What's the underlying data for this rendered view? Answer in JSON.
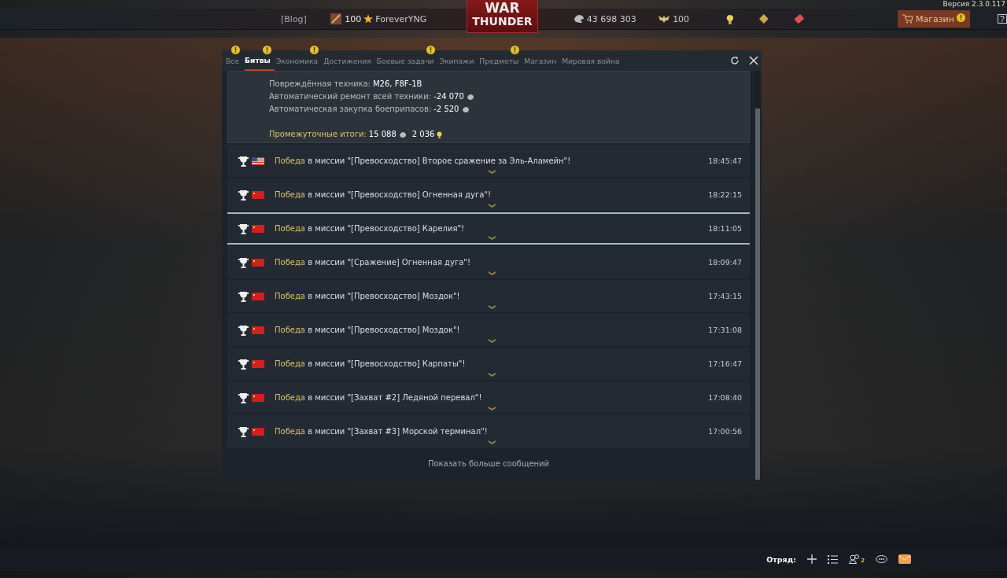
{
  "version": "Версия 2.3.0.117",
  "topbar": {
    "blog": "[Blog]",
    "level": "100",
    "username": "ForeverYNG",
    "logo_top": "WAR",
    "logo_bottom": "THUNDER",
    "silver": "43 698 303",
    "gold": "100",
    "shop": {
      "label": "Магазин",
      "alert": true
    },
    "help": "?"
  },
  "tabs": [
    {
      "label": "Все",
      "selected": false,
      "alert": true
    },
    {
      "label": "Битвы",
      "selected": true,
      "alert": true
    },
    {
      "label": "Экономика",
      "selected": false,
      "alert": true
    },
    {
      "label": "Достижения",
      "selected": false,
      "alert": false
    },
    {
      "label": "Боевые задачи",
      "selected": false,
      "alert": true
    },
    {
      "label": "Экипажи",
      "selected": false,
      "alert": false
    },
    {
      "label": "Предметы",
      "selected": false,
      "alert": true
    },
    {
      "label": "Магазин",
      "selected": false,
      "alert": false
    },
    {
      "label": "Мировая война",
      "selected": false,
      "alert": false
    }
  ],
  "summary": [
    {
      "kind": "plain",
      "label": "Повреждённая техника:",
      "value": "M26, F8F-1B"
    },
    {
      "kind": "silver",
      "label": "Автоматический ремонт всей техники:",
      "value": "-24 070"
    },
    {
      "kind": "silver",
      "label": "Автоматическая закупка боеприпасов:",
      "value": "-2 520"
    },
    {
      "kind": "total",
      "label": "Промежуточные итоги:",
      "value": "15 088",
      "value2": "2 036"
    }
  ],
  "messages": [
    {
      "result": "Победа",
      "text": "в миссии \"[Превосходство] Второе сражение за Эль-Аламейн\"!",
      "time": "18:45:47",
      "kind": "us",
      "selected": false
    },
    {
      "result": "Победа",
      "text": "в миссии \"[Превосходство] Огненная дуга\"!",
      "time": "18:22:15",
      "kind": "ussr",
      "selected": false
    },
    {
      "result": "Победа",
      "text": "в миссии \"[Превосходство] Карелия\"!",
      "time": "18:11:05",
      "kind": "ussr",
      "selected": true
    },
    {
      "result": "Победа",
      "text": "в миссии \"[Сражение] Огненная дуга\"!",
      "time": "18:09:47",
      "kind": "ussr",
      "selected": false
    },
    {
      "result": "Победа",
      "text": "в миссии \"[Превосходство] Моздок\"!",
      "time": "17:43:15",
      "kind": "ussr",
      "selected": false
    },
    {
      "result": "Победа",
      "text": "в миссии \"[Превосходство] Моздок\"!",
      "time": "17:31:08",
      "kind": "ussr",
      "selected": false
    },
    {
      "result": "Победа",
      "text": "в миссии \"[Превосходство] Карпаты\"!",
      "time": "17:16:47",
      "kind": "ussr",
      "selected": false
    },
    {
      "result": "Победа",
      "text": "в миссии \"[Захват #2] Ледяной перевал\"!",
      "time": "17:08:40",
      "kind": "ussr",
      "selected": false
    },
    {
      "result": "Победа",
      "text": "в миссии \"[Захват #3] Морской терминал\"!",
      "time": "17:00:56",
      "kind": "ussr",
      "selected": false
    }
  ],
  "show_more": "Показать больше сообщений",
  "bottombar": {
    "squad_label": "Отряд:",
    "friends_count": "2"
  }
}
